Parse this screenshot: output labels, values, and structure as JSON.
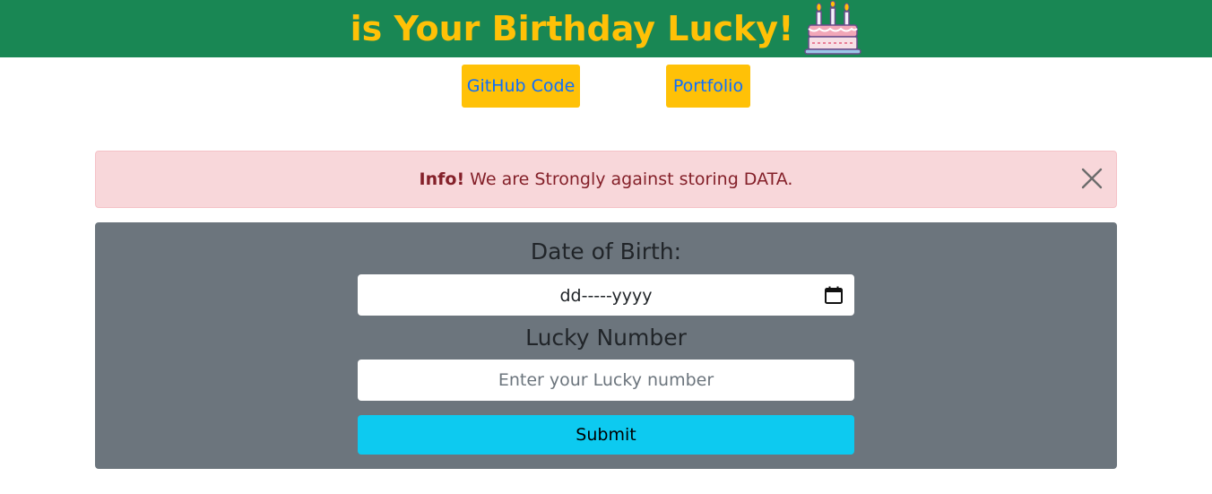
{
  "header": {
    "title": "is Your Birthday Lucky!",
    "icon": "birthday-cake-icon",
    "background_color": "#198754",
    "title_color": "#ffc107"
  },
  "links": {
    "github_label": "GitHub Code",
    "portfolio_label": "Portfolio",
    "button_color": "#ffc107",
    "text_color": "#0d6efd"
  },
  "alert": {
    "strong": "Info!",
    "message": " We are Strongly against storing DATA.",
    "close_icon": "close-icon",
    "background_color": "#f8d7da",
    "text_color": "#842029"
  },
  "form": {
    "dob_label": "Date of Birth:",
    "dob_value": "dd-----yyyy",
    "calendar_icon": "calendar-icon",
    "lucky_label": "Lucky Number",
    "lucky_placeholder": "Enter your Lucky number",
    "lucky_value": "",
    "submit_label": "Submit",
    "panel_color": "#6c757d",
    "submit_color": "#0dcaf0"
  }
}
